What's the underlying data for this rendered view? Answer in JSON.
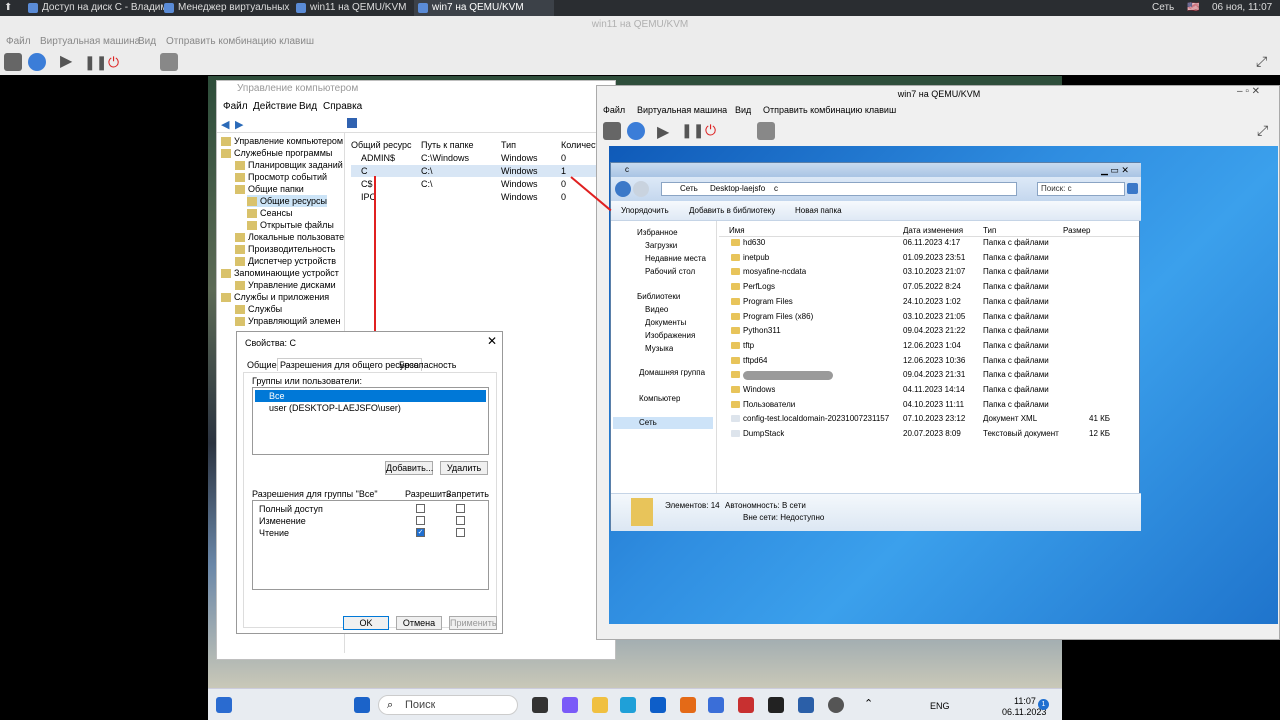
{
  "host_taskbar": {
    "tabs": [
      {
        "label": "Доступ на диск С - Владим..."
      },
      {
        "label": "Менеджер виртуальных м..."
      },
      {
        "label": "win11 на QEMU/KVM"
      },
      {
        "label": "win7 на QEMU/KVM"
      }
    ],
    "network_label": "Сеть",
    "clock": "06 ноя, 11:07"
  },
  "outer_viewer": {
    "title": "win11 на QEMU/KVM",
    "menu": [
      "Файл",
      "Виртуальная машина",
      "Вид",
      "Отправить комбинацию клавиш"
    ]
  },
  "computer_management": {
    "title": "Управление компьютером",
    "menu": [
      "Файл",
      "Действие",
      "Вид",
      "Справка"
    ],
    "tree": [
      "Управление компьютером (л",
      "Служебные программы",
      "Планировщик заданий",
      "Просмотр событий",
      "Общие папки",
      "Общие ресурсы",
      "Сеансы",
      "Открытые файлы",
      "Локальные пользовате",
      "Производительность",
      "Диспетчер устройств",
      "Запоминающие устройст",
      "Управление дисками",
      "Службы и приложения",
      "Службы",
      "Управляющий элемен"
    ],
    "columns": [
      "Общий ресурс",
      "Путь к папке",
      "Тип",
      "Количест"
    ],
    "rows": [
      [
        "ADMIN$",
        "C:\\Windows",
        "Windows",
        "0"
      ],
      [
        "C",
        "C:\\",
        "Windows",
        "1"
      ],
      [
        "C$",
        "C:\\",
        "Windows",
        "0"
      ],
      [
        "IPC",
        "",
        "Windows",
        "0"
      ]
    ]
  },
  "properties_dialog": {
    "title": "Свойства: C",
    "tabs": [
      "Общие",
      "Разрешения для общего ресурса",
      "Безопасность"
    ],
    "groups_label": "Группы или пользователи:",
    "users": [
      "Все",
      "user (DESKTOP-LAEJSFO\\user)"
    ],
    "add_label": "Добавить...",
    "remove_label": "Удалить",
    "perm_label": "Разрешения для группы \"Все\"",
    "allow_label": "Разрешить",
    "deny_label": "Запретить",
    "permissions": [
      {
        "name": "Полный доступ",
        "allow": false,
        "deny": false
      },
      {
        "name": "Изменение",
        "allow": false,
        "deny": false
      },
      {
        "name": "Чтение",
        "allow": true,
        "deny": false
      }
    ],
    "ok_label": "OK",
    "cancel_label": "Отмена",
    "apply_label": "Применить"
  },
  "win7_viewer": {
    "title": "win7 на QEMU/KVM",
    "menu": [
      "Файл",
      "Виртуальная машина",
      "Вид",
      "Отправить комбинацию клавиш"
    ]
  },
  "explorer": {
    "title": "c",
    "breadcrumb": [
      "Сеть",
      "Desktop-laejsfo",
      "c"
    ],
    "search_placeholder": "Поиск: c",
    "commands": [
      "Упорядочить",
      "Добавить в библиотеку",
      "Новая папка"
    ],
    "nav": [
      "Избранное",
      "Загрузки",
      "Недавние места",
      "Рабочий стол",
      "Библиотеки",
      "Видео",
      "Документы",
      "Изображения",
      "Музыка",
      "Домашняя группа",
      "Компьютер",
      "Сеть"
    ],
    "columns": [
      "Имя",
      "Дата изменения",
      "Тип",
      "Размер"
    ],
    "files": [
      [
        "hd630",
        "06.11.2023 4:17",
        "Папка с файлами",
        ""
      ],
      [
        "inetpub",
        "01.09.2023 23:51",
        "Папка с файлами",
        ""
      ],
      [
        "mosyafine-ncdata",
        "03.10.2023 21:07",
        "Папка с файлами",
        ""
      ],
      [
        "PerfLogs",
        "07.05.2022 8:24",
        "Папка с файлами",
        ""
      ],
      [
        "Program Files",
        "24.10.2023 1:02",
        "Папка с файлами",
        ""
      ],
      [
        "Program Files (x86)",
        "03.10.2023 21:05",
        "Папка с файлами",
        ""
      ],
      [
        "Python311",
        "09.04.2023 21:22",
        "Папка с файлами",
        ""
      ],
      [
        "tftp",
        "12.06.2023 1:04",
        "Папка с файлами",
        ""
      ],
      [
        "tftpd64",
        "12.06.2023 10:36",
        "Папка с файлами",
        ""
      ],
      [
        "",
        "09.04.2023 21:31",
        "Папка с файлами",
        ""
      ],
      [
        "Windows",
        "04.11.2023 14:14",
        "Папка с файлами",
        ""
      ],
      [
        "Пользователи",
        "04.10.2023 11:11",
        "Папка с файлами",
        ""
      ],
      [
        "config-test.localdomain-20231007231157",
        "07.10.2023 23:12",
        "Документ XML",
        "41 КБ"
      ],
      [
        "DumpStack",
        "20.07.2023 8:09",
        "Текстовый документ",
        "12 КБ"
      ]
    ],
    "status_count": "Элементов: 14",
    "status_offline": "Автономность: В сети",
    "status_offline2": "Вне сети: Недоступно"
  },
  "w11_taskbar": {
    "search_label": "Поиск",
    "lang": "ENG",
    "time": "11:07",
    "date": "06.11.2023",
    "badge": "1"
  }
}
